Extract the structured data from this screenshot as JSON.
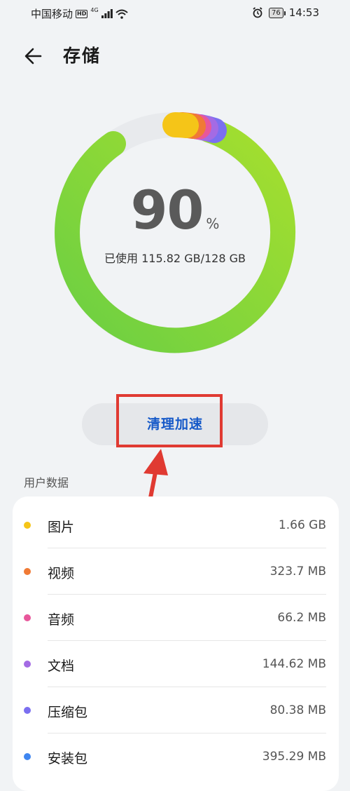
{
  "status_bar": {
    "carrier": "中国移动",
    "hd": "HD",
    "network": "4G",
    "battery": "76",
    "time": "14:53"
  },
  "header": {
    "title": "存储"
  },
  "storage": {
    "percent": "90",
    "percent_unit": "%",
    "used_text": "已使用 115.82 GB/128 GB",
    "ring_colors": [
      "#f5c518",
      "#f07a35",
      "#e8579b",
      "#a46be4",
      "#7b6ff0",
      "#8cd33c"
    ]
  },
  "actions": {
    "clean_label": "清理加速"
  },
  "user_data": {
    "section_title": "用户数据",
    "items": [
      {
        "name": "图片",
        "size": "1.66 GB",
        "color": "#f5c518"
      },
      {
        "name": "视频",
        "size": "323.7 MB",
        "color": "#f07a35"
      },
      {
        "name": "音频",
        "size": "66.2 MB",
        "color": "#e8579b"
      },
      {
        "name": "文档",
        "size": "144.62 MB",
        "color": "#a46be4"
      },
      {
        "name": "压缩包",
        "size": "80.38 MB",
        "color": "#7b6ff0"
      },
      {
        "name": "安装包",
        "size": "395.29 MB",
        "color": "#3f86f0"
      }
    ]
  }
}
